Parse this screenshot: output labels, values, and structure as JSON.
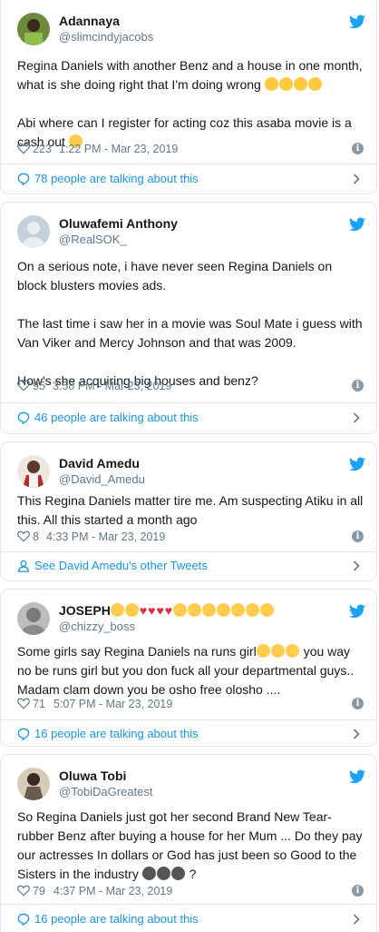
{
  "colors": {
    "accent": "#1da1f2",
    "link": "#1b95e0",
    "muted": "#657786",
    "border": "#e1e8ed"
  },
  "tweets": [
    {
      "name": "Adannaya",
      "handle": "@slimcindyjacobs",
      "text": [
        "Regina Daniels with another Benz and a house in one month, what is she doing right that I'm doing wrong",
        "Abi where can I register for acting coz this asaba movie is a cash out"
      ],
      "likes": "223",
      "time": "1:22 PM - Mar 23, 2019",
      "footer": "78 people are talking about this",
      "footer_icon": "comment-icon"
    },
    {
      "name": "Oluwafemi Anthony",
      "handle": "@RealSOK_",
      "text": [
        "On a serious note, i have never seen Regina Daniels on block blusters movies ads.",
        "The last time i saw her in a movie was Soul Mate i guess with Van Viker and Mercy Johnson and that was 2009.",
        "How's she acquiring big houses and benz?"
      ],
      "likes": "95",
      "time": "3:58 PM - Mar 23, 2019",
      "footer": "46 people are talking about this",
      "footer_icon": "comment-icon"
    },
    {
      "name": "David Amedu",
      "handle": "@David_Amedu",
      "text": [
        "This Regina Daniels matter tire me. Am suspecting Atiku in all this. All this started a month ago"
      ],
      "likes": "8",
      "time": "4:33 PM - Mar 23, 2019",
      "footer": "See David Amedu's other Tweets",
      "footer_icon": "person-icon"
    },
    {
      "name": "JOSEPH",
      "handle": "@chizzy_boss",
      "text": [
        "Some girls say Regina Daniels na runs girl",
        "you way no be runs girl but you don fuck all your departmental guys.. Madam clam down you be osho free olosho ...."
      ],
      "likes": "71",
      "time": "5:07 PM - Mar 23, 2019",
      "footer": "16 people are talking about this",
      "footer_icon": "comment-icon"
    },
    {
      "name": "Oluwa Tobi",
      "handle": "@TobiDaGreatest",
      "text": [
        "So Regina Daniels just got her second Brand New Tear-rubber Benz after buying a house for her Mum ... Do they pay our actresses In dollars or God has just been so Good to the Sisters in the industry",
        "?"
      ],
      "likes": "79",
      "time": "4:37 PM - Mar 23, 2019",
      "footer": "16 people are talking about this",
      "footer_icon": "comment-icon"
    }
  ]
}
